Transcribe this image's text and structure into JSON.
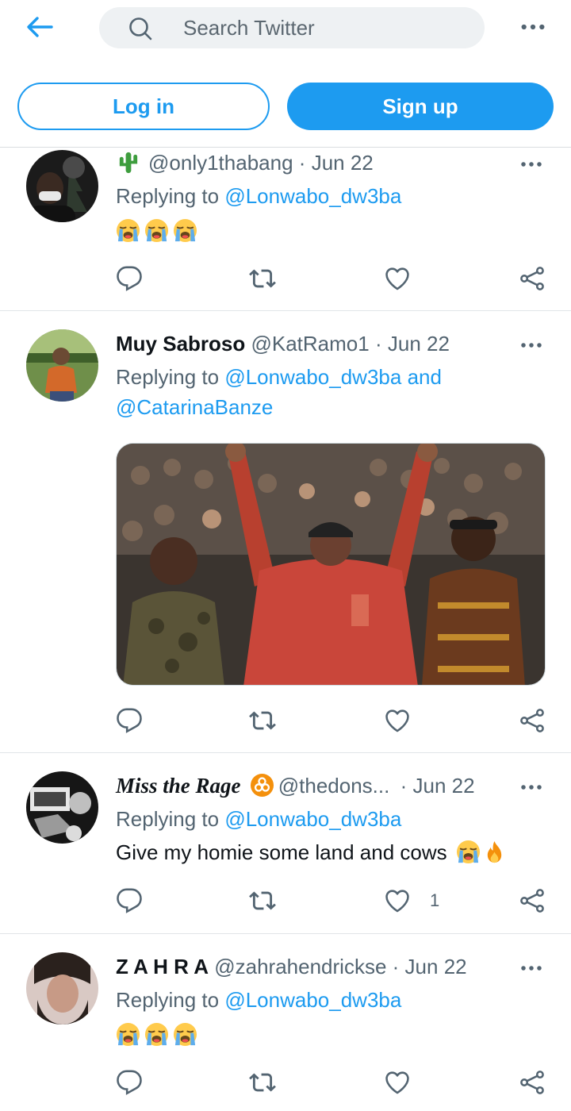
{
  "header": {
    "back_icon": "arrow-left-icon",
    "search_placeholder": "Search Twitter",
    "search_icon": "search-icon",
    "more_icon": "more-horizontal-icon",
    "login_label": "Log in",
    "signup_label": "Sign up"
  },
  "colors": {
    "accent": "#1d9bf0",
    "secondary_text": "#536471",
    "search_bg": "#eef1f3"
  },
  "tweets": [
    {
      "display_name": "",
      "name_emoji": "cactus",
      "handle": "@only1thabang",
      "separator": "·",
      "date": "Jun 22",
      "replying_prefix": "Replying to",
      "mentions": [
        "@Lonwabo_dw3ba"
      ],
      "text": "",
      "emojis": [
        "loudly-crying-face",
        "loudly-crying-face",
        "loudly-crying-face"
      ],
      "likes": ""
    },
    {
      "display_name": "Muy Sabroso",
      "handle": "@KatRamo1",
      "separator": "·",
      "date": "Jun 22",
      "replying_prefix": "Replying to",
      "mentions": [
        "@Lonwabo_dw3ba",
        "@CatarinaBanze"
      ],
      "mention_joiner": "and",
      "media": "photo of a man in a red sweatshirt raising both arms in a crowd",
      "likes": ""
    },
    {
      "display_name": "Miss the Rage",
      "name_emoji": "biohazard",
      "handle": "@thedons...",
      "separator": "·",
      "date": "Jun 22",
      "replying_prefix": "Replying to",
      "mentions": [
        "@Lonwabo_dw3ba"
      ],
      "text": "Give my homie some land and cows",
      "emojis": [
        "loudly-crying-face",
        "fire"
      ],
      "likes": "1"
    },
    {
      "display_name": "Z A H R A",
      "handle": "@zahrahendrickse",
      "separator": "·",
      "date": "Jun 22",
      "replying_prefix": "Replying to",
      "mentions": [
        "@Lonwabo_dw3ba"
      ],
      "text": "",
      "emojis": [
        "loudly-crying-face",
        "loudly-crying-face",
        "loudly-crying-face"
      ],
      "likes": ""
    }
  ],
  "action_icons": [
    "reply-icon",
    "retweet-icon",
    "like-icon",
    "share-icon"
  ]
}
